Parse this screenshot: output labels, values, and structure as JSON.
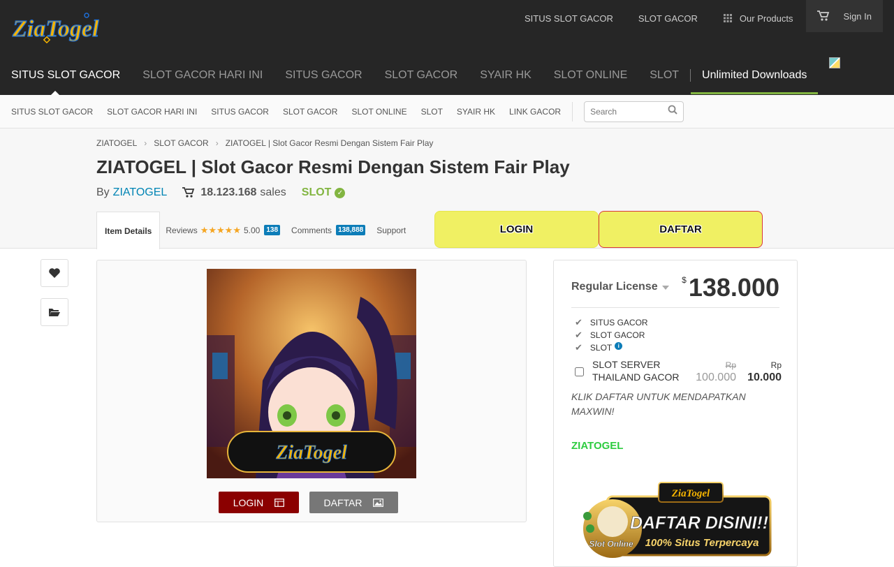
{
  "brand": {
    "logo_text": "ZiaTogel"
  },
  "topnav": {
    "items": [
      "SITUS SLOT GACOR",
      "SLOT GACOR"
    ],
    "products": "Our Products",
    "signin": "Sign In"
  },
  "mainnav": {
    "items": [
      "SITUS SLOT GACOR",
      "SLOT GACOR HARI INI",
      "SITUS GACOR",
      "SLOT GACOR",
      "SYAIR HK",
      "SLOT ONLINE",
      "SLOT"
    ],
    "unlimited": "Unlimited Downloads"
  },
  "subnav": {
    "items": [
      "SITUS SLOT GACOR",
      "SLOT GACOR HARI INI",
      "SITUS GACOR",
      "SLOT GACOR",
      "SLOT ONLINE",
      "SLOT",
      "SYAIR HK",
      "LINK GACOR"
    ],
    "search_placeholder": "Search"
  },
  "breadcrumb": [
    "ZIATOGEL",
    "SLOT GACOR",
    "ZIATOGEL | Slot Gacor Resmi Dengan Sistem Fair Play"
  ],
  "item": {
    "title": "ZIATOGEL | Slot Gacor Resmi Dengan Sistem Fair Play",
    "by": "By",
    "author": "ZIATOGEL",
    "sales_count": "18.123.168",
    "sales_label": "sales",
    "category": "SLOT"
  },
  "tabs": {
    "details": "Item Details",
    "reviews": "Reviews",
    "rating": "5.00",
    "rating_stars": 5,
    "reviews_count": "138",
    "comments": "Comments",
    "comments_count": "138,888",
    "support": "Support"
  },
  "cta": {
    "login": "LOGIN",
    "daftar": "DAFTAR"
  },
  "preview": {
    "login": "LOGIN",
    "daftar": "DAFTAR",
    "art_logo": "ZiaTogel"
  },
  "license": {
    "name": "Regular License",
    "currency": "$",
    "price": "138.000",
    "features": [
      "SITUS GACOR",
      "SLOT GACOR",
      "SLOT"
    ],
    "upsell_name": "SLOT SERVER THAILAND GACOR",
    "upsell_currency": "Rp",
    "upsell_old_price": "100.000",
    "upsell_new_price": "10.000",
    "promo": "KLIK DAFTAR UNTUK MENDAPATKAN MAXWIN!",
    "brand": "ZIATOGEL"
  },
  "banner": {
    "logo": "ZiaTogel",
    "headline": "DAFTAR DISINI!!",
    "tagline": "100% Situs Terpercaya",
    "badge": "Slot Online"
  },
  "colors": {
    "accent_green": "#82b541",
    "link_blue": "#0084b4",
    "cta_yellow": "#f0f063",
    "login_red": "#8b0000"
  }
}
